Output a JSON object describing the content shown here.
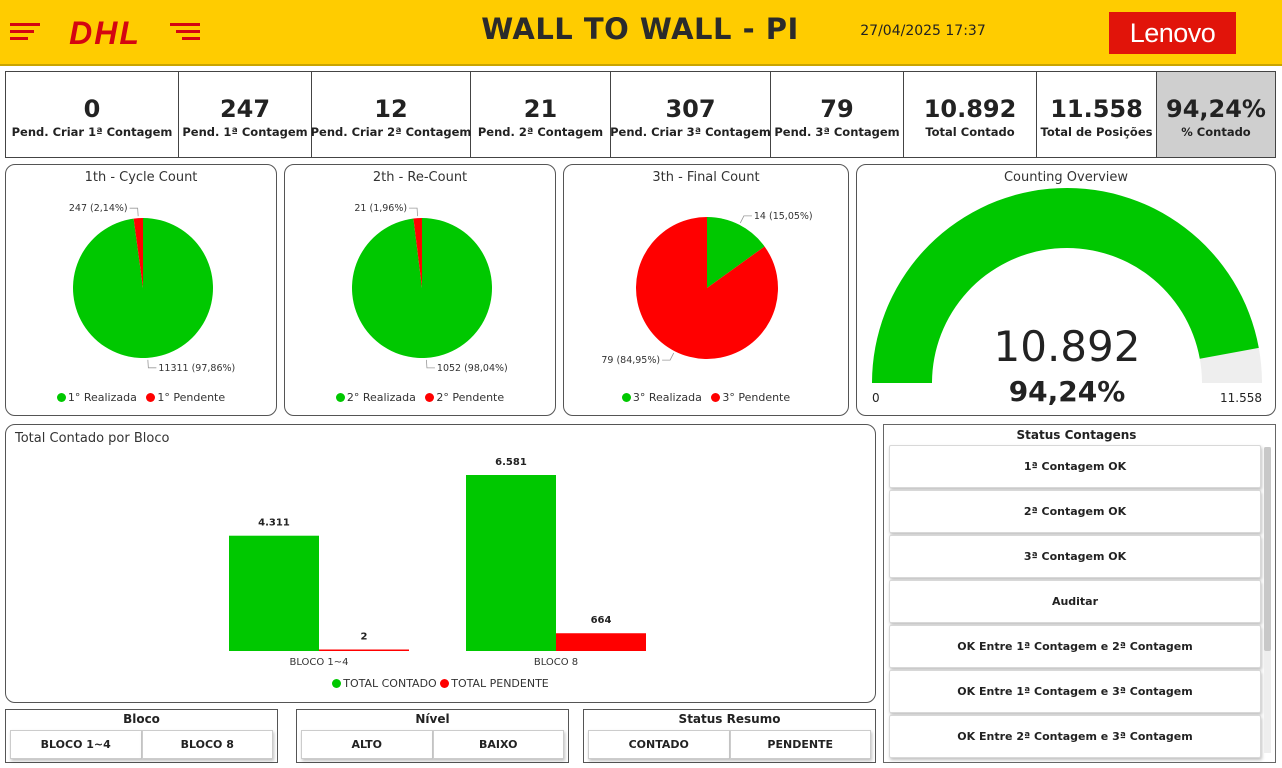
{
  "header": {
    "title": "WALL TO WALL - PI",
    "datetime": "27/04/2025 17:37",
    "left_logo": "DHL",
    "right_logo": "Lenovo",
    "colors": {
      "bar": "#ffcc00",
      "dhl_red": "#d40511",
      "lenovo_red": "#e1140a"
    }
  },
  "kpis": [
    {
      "value": "0",
      "label": "Pend. Criar 1ª Contagem"
    },
    {
      "value": "247",
      "label": "Pend. 1ª Contagem"
    },
    {
      "value": "12",
      "label": "Pend. Criar 2ª Contagem"
    },
    {
      "value": "21",
      "label": "Pend. 2ª Contagem"
    },
    {
      "value": "307",
      "label": "Pend. Criar 3ª Contagem"
    },
    {
      "value": "79",
      "label": "Pend. 3ª Contagem"
    },
    {
      "value": "10.892",
      "label": "Total Contado"
    },
    {
      "value": "11.558",
      "label": "Total de Posições"
    },
    {
      "value": "94,24%",
      "label": "% Contado"
    }
  ],
  "colors": {
    "green": "#00c800",
    "red": "#ff0000",
    "gray": "#eeeeee"
  },
  "chart_data": [
    {
      "type": "pie",
      "title": "1th - Cycle Count",
      "slices": [
        {
          "name": "1° Realizada",
          "value": 11311,
          "label": "11311 (97,86%)",
          "color": "#00c800"
        },
        {
          "name": "1° Pendente",
          "value": 247,
          "label": "247 (2,14%)",
          "color": "#ff0000"
        }
      ]
    },
    {
      "type": "pie",
      "title": "2th - Re-Count",
      "slices": [
        {
          "name": "2° Realizada",
          "value": 1052,
          "label": "1052 (98,04%)",
          "color": "#00c800"
        },
        {
          "name": "2° Pendente",
          "value": 21,
          "label": "21 (1,96%)",
          "color": "#ff0000"
        }
      ]
    },
    {
      "type": "pie",
      "title": "3th - Final Count",
      "slices": [
        {
          "name": "3° Realizada",
          "value": 14,
          "label": "14 (15,05%)",
          "color": "#00c800"
        },
        {
          "name": "3° Pendente",
          "value": 79,
          "label": "79 (84,95%)",
          "color": "#ff0000"
        }
      ]
    },
    {
      "type": "gauge",
      "title": "Counting Overview",
      "value": 10892,
      "value_label": "10.892",
      "percent_label": "94,24%",
      "min": 0,
      "max": 11558,
      "min_label": "0",
      "max_label": "11.558"
    },
    {
      "type": "bar",
      "title": "Total Contado por Bloco",
      "categories": [
        "BLOCO 1~4",
        "BLOCO 8"
      ],
      "series": [
        {
          "name": "TOTAL CONTADO",
          "values": [
            4311,
            6581
          ],
          "labels": [
            "4.311",
            "6.581"
          ],
          "color": "#00c800"
        },
        {
          "name": "TOTAL PENDENTE",
          "values": [
            2,
            664
          ],
          "labels": [
            "2",
            "664"
          ],
          "color": "#ff0000"
        }
      ],
      "legend": "bottom-center"
    }
  ],
  "status_contagens": {
    "title": "Status Contagens",
    "items": [
      "1ª Contagem OK",
      "2ª Contagem OK",
      "3ª Contagem OK",
      "Auditar",
      "OK Entre 1ª Contagem e 2ª Contagem",
      "OK Entre 1ª Contagem e 3ª Contagem",
      "OK Entre 2ª Contagem e 3ª Contagem"
    ]
  },
  "slicers": {
    "bloco": {
      "title": "Bloco",
      "options": [
        "BLOCO 1~4",
        "BLOCO 8"
      ]
    },
    "nivel": {
      "title": "Nível",
      "options": [
        "ALTO",
        "BAIXO"
      ]
    },
    "status_resumo": {
      "title": "Status Resumo",
      "options": [
        "CONTADO",
        "PENDENTE"
      ]
    }
  }
}
